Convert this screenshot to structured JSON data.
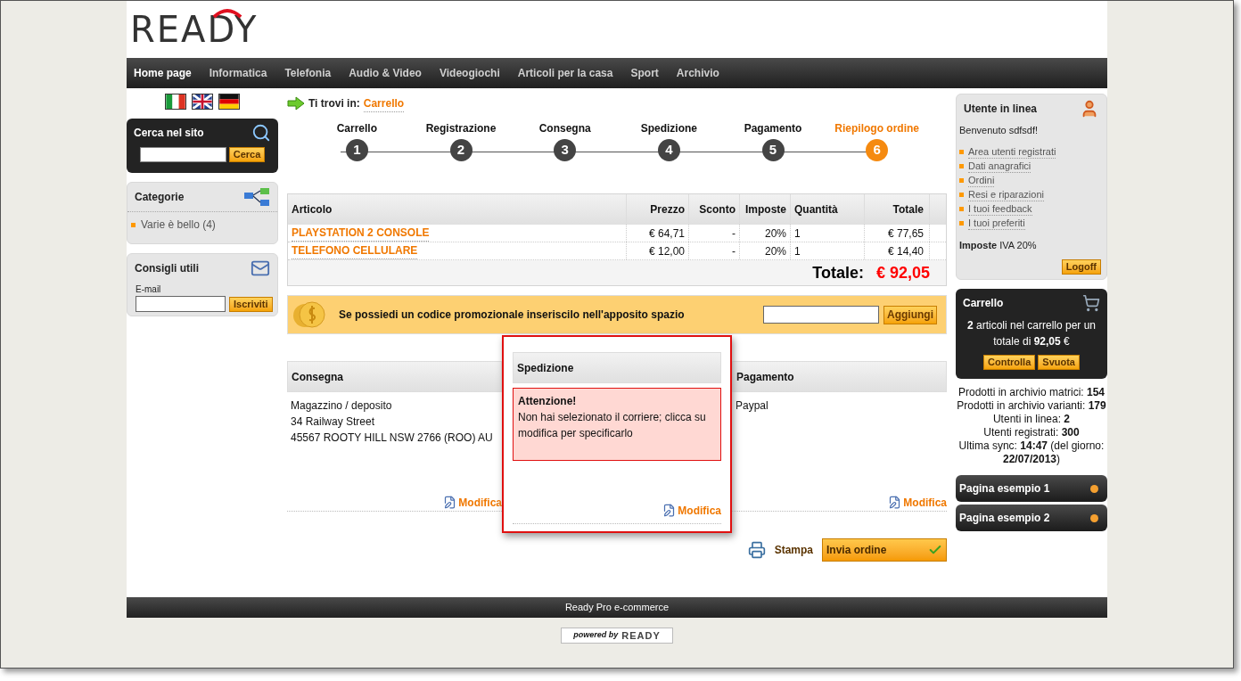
{
  "logo": "READY",
  "nav": [
    {
      "label": "Home page",
      "selected": true
    },
    {
      "label": "Informatica",
      "selected": false
    },
    {
      "label": "Telefonia",
      "selected": false
    },
    {
      "label": "Audio & Video",
      "selected": false
    },
    {
      "label": "Videogiochi",
      "selected": false
    },
    {
      "label": "Articoli per la casa",
      "selected": false
    },
    {
      "label": "Sport",
      "selected": false
    },
    {
      "label": "Archivio",
      "selected": false
    }
  ],
  "search": {
    "title": "Cerca nel sito",
    "button": "Cerca"
  },
  "categories": {
    "title": "Categorie",
    "items": [
      "Varie è bello (4)"
    ]
  },
  "newsletter": {
    "title": "Consigli utili",
    "label": "E-mail",
    "button": "Iscriviti"
  },
  "breadcrumb": {
    "label": "Ti trovi in:",
    "link": "Carrello"
  },
  "steps": [
    {
      "label": "Carrello",
      "number": "1",
      "selected": false
    },
    {
      "label": "Registrazione",
      "number": "2",
      "selected": false
    },
    {
      "label": "Consegna",
      "number": "3",
      "selected": false
    },
    {
      "label": "Spedizione",
      "number": "4",
      "selected": false
    },
    {
      "label": "Pagamento",
      "number": "5",
      "selected": false
    },
    {
      "label": "Riepilogo ordine",
      "number": "6",
      "selected": true
    }
  ],
  "cart_table": {
    "columns": [
      "Articolo",
      "Prezzo",
      "Sconto",
      "Imposte",
      "Quantità",
      "Totale"
    ],
    "rows": [
      [
        "PLAYSTATION 2 CONSOLE",
        "€ 64,71",
        "-",
        "20%",
        "1",
        "€ 77,65"
      ],
      [
        "TELEFONO CELLULARE",
        "€ 12,00",
        "-",
        "20%",
        "1",
        "€ 14,40"
      ]
    ],
    "total_label": "Totale:",
    "total_value": "€ 92,05"
  },
  "promo": {
    "text": "Se possiedi un codice promozionale inseriscilo nell'apposito spazio",
    "button": "Aggiungi"
  },
  "summary": [
    {
      "title": "Consegna",
      "highlighted": false,
      "lines": [
        "Magazzino / deposito",
        "34 Railway Street",
        "45567 ROOTY HILL NSW 2766 (ROO) AU"
      ],
      "link": "Modifica"
    },
    {
      "title": "Spedizione",
      "highlighted": true,
      "alert": {
        "title": "Attenzione!",
        "text": "Non hai selezionato il corriere; clicca su modifica per specificarlo"
      },
      "link": "Modifica"
    },
    {
      "title": "Pagamento",
      "highlighted": false,
      "lines": [
        "Paypal"
      ],
      "link": "Modifica"
    }
  ],
  "actions": {
    "print": "Stampa",
    "submit": "Invia ordine"
  },
  "user": {
    "title": "Utente in linea",
    "welcome": "Benvenuto sdfsdf!",
    "links": [
      "Area utenti registrati",
      "Dati anagrafici",
      "Ordini",
      "Resi e riparazioni",
      "I tuoi feedback",
      "I tuoi preferiti"
    ],
    "tax": "**Imposte** IVA 20%",
    "button": "Logoff"
  },
  "cart_box": {
    "title": "Carrello",
    "text": "**2** articoli nel carrello per un totale di **92,05** €",
    "buttons": [
      "Controlla",
      "Svuota"
    ]
  },
  "stats": [
    "Prodotti in archivio matrici: **154**",
    "Prodotti in archivio varianti: **179**",
    "Utenti in linea: **2**",
    "Utenti registrati: **300**",
    "Ultima sync: **14:47** (del giorno: **22/07/2013**)"
  ],
  "pages": [
    "Pagina esempio 1",
    "Pagina esempio 2"
  ],
  "footer": "Ready Pro e-commerce",
  "powered": {
    "prefix": "powered by",
    "brand": "READY"
  }
}
